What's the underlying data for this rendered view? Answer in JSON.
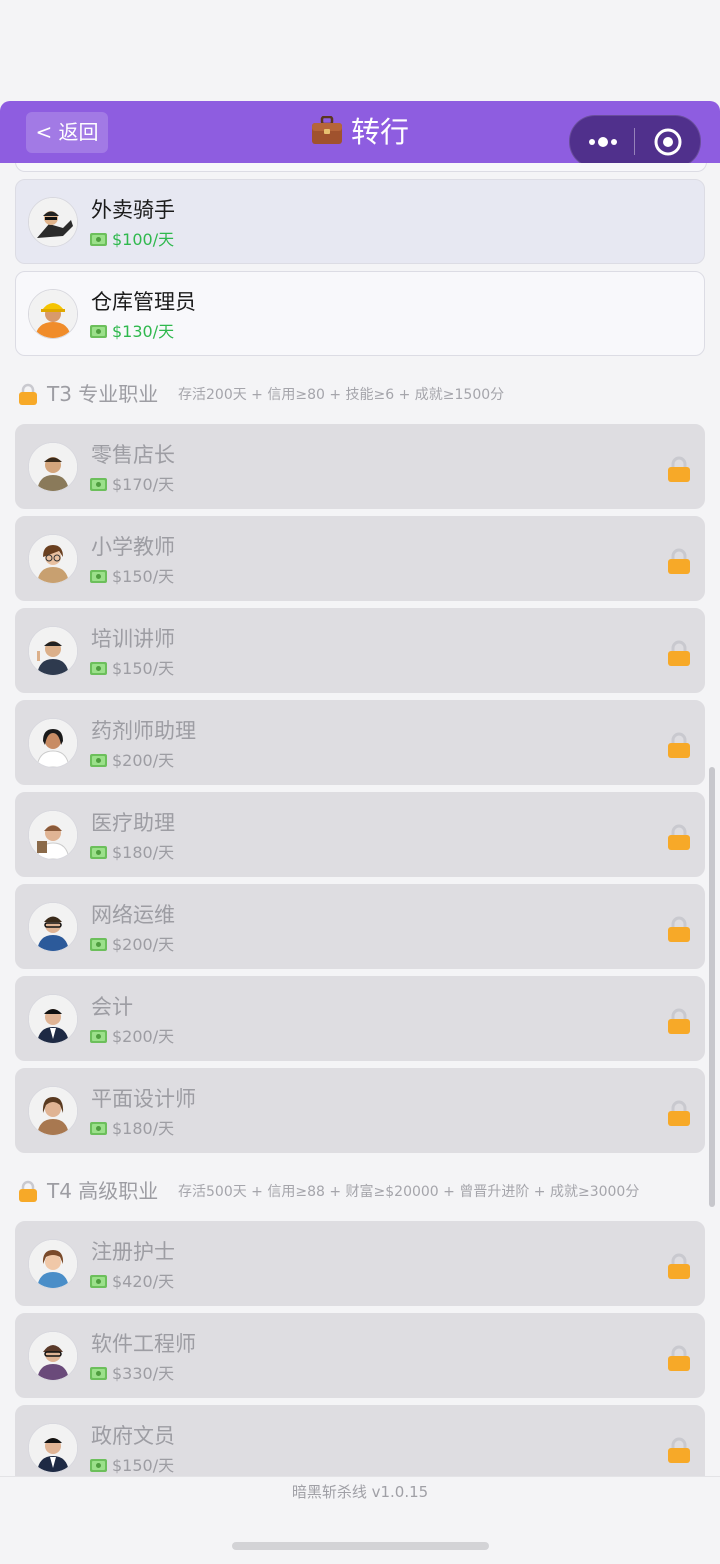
{
  "header": {
    "back_label": "< 返回",
    "title": "转行",
    "title_icon": "briefcase-icon"
  },
  "colors": {
    "header_bg": "#8e5de0",
    "salary_green": "#2fb84d",
    "lock_orange": "#f7a928",
    "locked_card_bg": "#dedde1",
    "selected_card_bg": "#e7e8f2"
  },
  "available_jobs": [
    {
      "name": "外卖骑手",
      "salary": "$100/天",
      "selected": true
    },
    {
      "name": "仓库管理员",
      "salary": "$130/天",
      "selected": false
    }
  ],
  "sections": [
    {
      "title": "T3 专业职业",
      "requirements": "存活200天 + 信用≥80 + 技能≥6 + 成就≥1500分",
      "locked": true,
      "jobs": [
        {
          "name": "零售店长",
          "salary": "$170/天"
        },
        {
          "name": "小学教师",
          "salary": "$150/天"
        },
        {
          "name": "培训讲师",
          "salary": "$150/天"
        },
        {
          "name": "药剂师助理",
          "salary": "$200/天"
        },
        {
          "name": "医疗助理",
          "salary": "$180/天"
        },
        {
          "name": "网络运维",
          "salary": "$200/天"
        },
        {
          "name": "会计",
          "salary": "$200/天"
        },
        {
          "name": "平面设计师",
          "salary": "$180/天"
        }
      ]
    },
    {
      "title": "T4 高级职业",
      "requirements": "存活500天 + 信用≥88 + 财富≥$20000 + 曾晋升进阶 + 成就≥3000分",
      "locked": true,
      "jobs": [
        {
          "name": "注册护士",
          "salary": "$420/天"
        },
        {
          "name": "软件工程师",
          "salary": "$330/天"
        },
        {
          "name": "政府文员",
          "salary": "$150/天"
        }
      ]
    }
  ],
  "footer": {
    "version": "暗黑斩杀线 v1.0.15"
  }
}
